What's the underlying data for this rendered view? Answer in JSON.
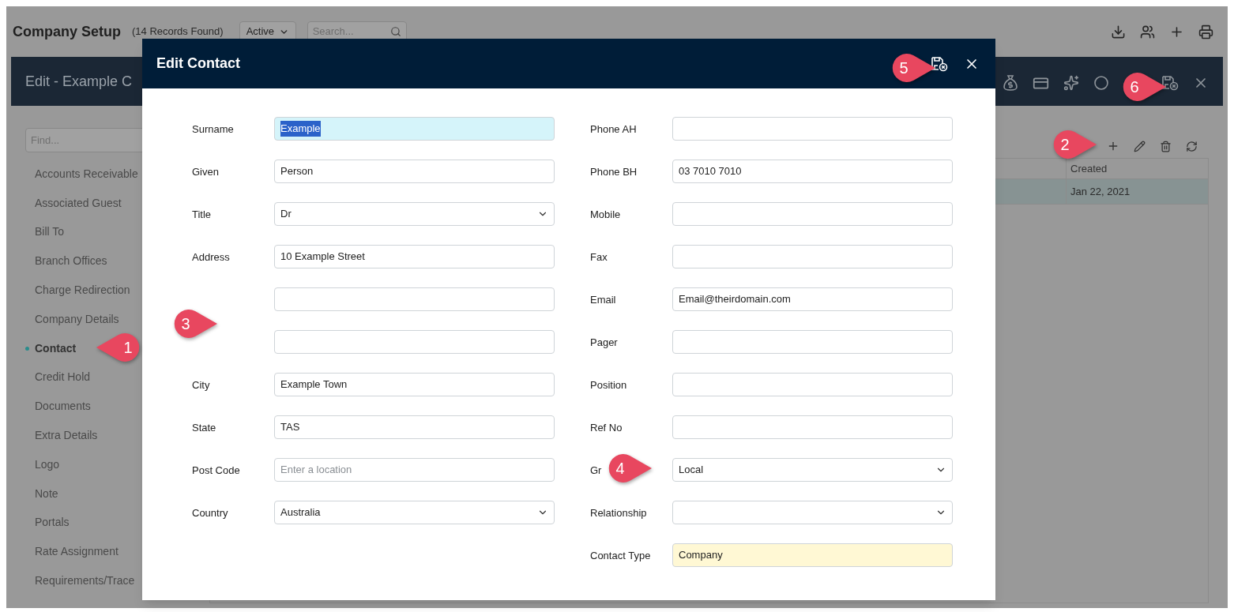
{
  "page": {
    "title": "Company Setup",
    "records": "(14 Records Found)",
    "status_filter": "Active",
    "search": {
      "placeholder": "Search..."
    }
  },
  "edit_bar": {
    "title": "Edit - Example C"
  },
  "sidebar": {
    "find": {
      "placeholder": "Find..."
    },
    "items": [
      {
        "label": "Accounts Receivable",
        "selected": false
      },
      {
        "label": "Associated Guest",
        "selected": false
      },
      {
        "label": "Bill To",
        "selected": false
      },
      {
        "label": "Branch Offices",
        "selected": false
      },
      {
        "label": "Charge Redirection",
        "selected": false
      },
      {
        "label": "Company Details",
        "selected": false
      },
      {
        "label": "Contact",
        "selected": true
      },
      {
        "label": "Credit Hold",
        "selected": false
      },
      {
        "label": "Documents",
        "selected": false
      },
      {
        "label": "Extra Details",
        "selected": false
      },
      {
        "label": "Logo",
        "selected": false
      },
      {
        "label": "Note",
        "selected": false
      },
      {
        "label": "Portals",
        "selected": false
      },
      {
        "label": "Rate Assignment",
        "selected": false
      },
      {
        "label": "Requirements/Trace",
        "selected": false
      }
    ]
  },
  "table": {
    "columns": [
      "Created"
    ],
    "rows": [
      {
        "cells": [
          "Jan 22, 2021"
        ],
        "selected": true
      }
    ]
  },
  "dialog": {
    "title": "Edit Contact",
    "left_fields": [
      {
        "label": "Surname",
        "kind": "text",
        "value": "Example",
        "highlighted": true,
        "color": "#d5f4fa"
      },
      {
        "label": "Given",
        "kind": "text",
        "value": "Person"
      },
      {
        "label": "Title",
        "kind": "select",
        "value": "Dr"
      },
      {
        "label": "Address",
        "kind": "text",
        "value": "10 Example Street"
      },
      {
        "kind": "text"
      },
      {
        "kind": "text"
      },
      {
        "label": "City",
        "kind": "text",
        "value": "Example Town"
      },
      {
        "label": "State",
        "kind": "text",
        "value": "TAS"
      },
      {
        "label": "Post Code",
        "kind": "text",
        "placeholder": "Enter a location"
      },
      {
        "label": "Country",
        "kind": "select",
        "value": "Australia"
      }
    ],
    "right_fields": [
      {
        "label": "Phone AH",
        "kind": "text"
      },
      {
        "label": "Phone BH",
        "kind": "text",
        "value": "03 7010 7010"
      },
      {
        "label": "Mobile",
        "kind": "text"
      },
      {
        "label": "Fax",
        "kind": "text"
      },
      {
        "label": "Email",
        "kind": "text",
        "value": "Email@theirdomain.com"
      },
      {
        "label": "Pager",
        "kind": "text"
      },
      {
        "label": "Position",
        "kind": "text"
      },
      {
        "label": "Ref No",
        "kind": "text"
      },
      {
        "label": "Gr",
        "kind": "select",
        "value": "Local"
      },
      {
        "label": "Relationship",
        "kind": "select"
      },
      {
        "label": "Contact Type",
        "kind": "text",
        "value": "Company",
        "color": "#fff8d4"
      }
    ]
  },
  "callouts": [
    {
      "label": "1",
      "kind": "pointer-left"
    },
    {
      "label": "2",
      "kind": "pointer-right"
    },
    {
      "label": "3",
      "kind": "pointer-right"
    },
    {
      "label": "4",
      "kind": "pointer-right"
    },
    {
      "label": "5",
      "kind": "pointer-right"
    },
    {
      "label": "6",
      "kind": "pointer-right"
    }
  ]
}
